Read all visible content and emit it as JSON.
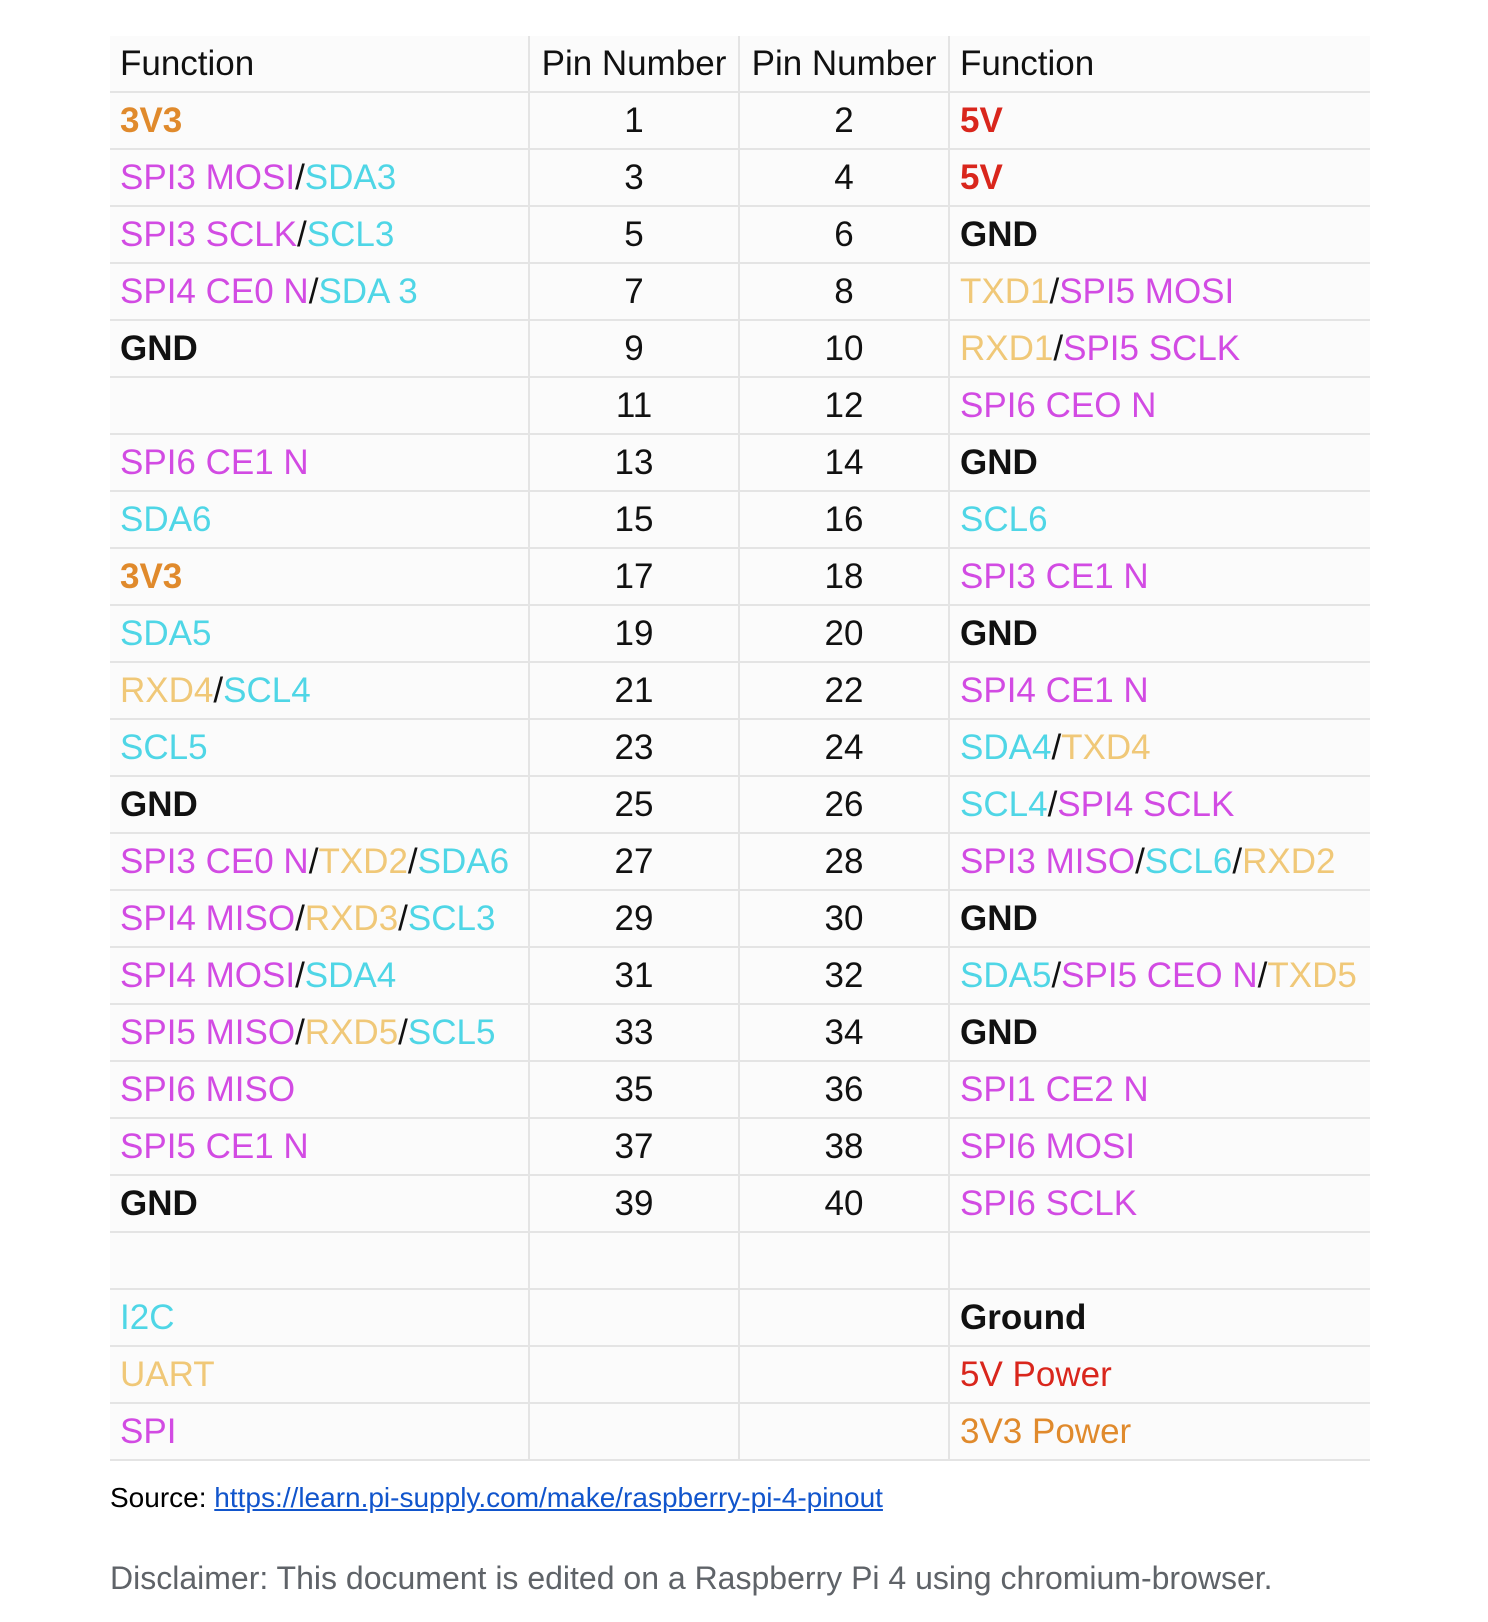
{
  "colors": {
    "spi": "#d24be3",
    "i2c": "#4fd6e6",
    "uart": "#f0c878",
    "power5v": "#d9261c",
    "power3v3": "#e08a2c",
    "ground": "#111111"
  },
  "table": {
    "headers": [
      "Function",
      "Pin Number",
      "Pin Number",
      "Function"
    ],
    "rows": [
      {
        "left": [
          {
            "t": "3V3",
            "c": "power3v3",
            "b": true
          }
        ],
        "pin_left": "1",
        "pin_right": "2",
        "right": [
          {
            "t": "5V",
            "c": "power5v",
            "b": true
          }
        ]
      },
      {
        "left": [
          {
            "t": "SPI3 MOSI",
            "c": "spi"
          },
          {
            "t": "/",
            "c": "ground"
          },
          {
            "t": "SDA3",
            "c": "i2c"
          }
        ],
        "pin_left": "3",
        "pin_right": "4",
        "right": [
          {
            "t": "5V",
            "c": "power5v",
            "b": true
          }
        ]
      },
      {
        "left": [
          {
            "t": "SPI3 SCLK",
            "c": "spi"
          },
          {
            "t": "/",
            "c": "ground"
          },
          {
            "t": "SCL3",
            "c": "i2c"
          }
        ],
        "pin_left": "5",
        "pin_right": "6",
        "right": [
          {
            "t": "GND",
            "c": "ground",
            "b": true
          }
        ]
      },
      {
        "left": [
          {
            "t": "SPI4 CE0 N",
            "c": "spi"
          },
          {
            "t": "/",
            "c": "ground"
          },
          {
            "t": "SDA 3",
            "c": "i2c"
          }
        ],
        "pin_left": "7",
        "pin_right": "8",
        "right": [
          {
            "t": "TXD1",
            "c": "uart"
          },
          {
            "t": "/",
            "c": "ground"
          },
          {
            "t": "SPI5 MOSI",
            "c": "spi"
          }
        ]
      },
      {
        "left": [
          {
            "t": "GND",
            "c": "ground",
            "b": true
          }
        ],
        "pin_left": "9",
        "pin_right": "10",
        "right": [
          {
            "t": "RXD1",
            "c": "uart"
          },
          {
            "t": "/",
            "c": "ground"
          },
          {
            "t": "SPI5 SCLK",
            "c": "spi"
          }
        ]
      },
      {
        "left": [],
        "pin_left": "11",
        "pin_right": "12",
        "right": [
          {
            "t": "SPI6 CEO N",
            "c": "spi"
          }
        ]
      },
      {
        "left": [
          {
            "t": "SPI6 CE1 N",
            "c": "spi"
          }
        ],
        "pin_left": "13",
        "pin_right": "14",
        "right": [
          {
            "t": "GND",
            "c": "ground",
            "b": true
          }
        ]
      },
      {
        "left": [
          {
            "t": "SDA6",
            "c": "i2c"
          }
        ],
        "pin_left": "15",
        "pin_right": "16",
        "right": [
          {
            "t": "SCL6",
            "c": "i2c"
          }
        ]
      },
      {
        "left": [
          {
            "t": "3V3",
            "c": "power3v3",
            "b": true
          }
        ],
        "pin_left": "17",
        "pin_right": "18",
        "right": [
          {
            "t": "SPI3 CE1 N",
            "c": "spi"
          }
        ]
      },
      {
        "left": [
          {
            "t": "SDA5",
            "c": "i2c"
          }
        ],
        "pin_left": "19",
        "pin_right": "20",
        "right": [
          {
            "t": "GND",
            "c": "ground",
            "b": true
          }
        ]
      },
      {
        "left": [
          {
            "t": "RXD4",
            "c": "uart"
          },
          {
            "t": "/",
            "c": "ground"
          },
          {
            "t": "SCL4",
            "c": "i2c"
          }
        ],
        "pin_left": "21",
        "pin_right": "22",
        "right": [
          {
            "t": "SPI4 CE1 N",
            "c": "spi"
          }
        ]
      },
      {
        "left": [
          {
            "t": "SCL5",
            "c": "i2c"
          }
        ],
        "pin_left": "23",
        "pin_right": "24",
        "right": [
          {
            "t": "SDA4",
            "c": "i2c"
          },
          {
            "t": "/",
            "c": "ground"
          },
          {
            "t": "TXD4",
            "c": "uart"
          }
        ]
      },
      {
        "left": [
          {
            "t": "GND",
            "c": "ground",
            "b": true
          }
        ],
        "pin_left": "25",
        "pin_right": "26",
        "right": [
          {
            "t": "SCL4",
            "c": "i2c"
          },
          {
            "t": "/",
            "c": "ground"
          },
          {
            "t": "SPI4 SCLK",
            "c": "spi"
          }
        ]
      },
      {
        "left": [
          {
            "t": "SPI3 CE0 N",
            "c": "spi"
          },
          {
            "t": "/",
            "c": "ground"
          },
          {
            "t": "TXD2",
            "c": "uart"
          },
          {
            "t": "/",
            "c": "ground"
          },
          {
            "t": "SDA6",
            "c": "i2c"
          }
        ],
        "pin_left": "27",
        "pin_right": "28",
        "right": [
          {
            "t": "SPI3 MISO",
            "c": "spi"
          },
          {
            "t": "/",
            "c": "ground"
          },
          {
            "t": "SCL6",
            "c": "i2c"
          },
          {
            "t": "/",
            "c": "ground"
          },
          {
            "t": "RXD2",
            "c": "uart"
          }
        ]
      },
      {
        "left": [
          {
            "t": "SPI4 MISO",
            "c": "spi"
          },
          {
            "t": "/",
            "c": "ground"
          },
          {
            "t": "RXD3",
            "c": "uart"
          },
          {
            "t": "/",
            "c": "ground"
          },
          {
            "t": "SCL3",
            "c": "i2c"
          }
        ],
        "pin_left": "29",
        "pin_right": "30",
        "right": [
          {
            "t": "GND",
            "c": "ground",
            "b": true
          }
        ]
      },
      {
        "left": [
          {
            "t": "SPI4 MOSI",
            "c": "spi"
          },
          {
            "t": "/",
            "c": "ground"
          },
          {
            "t": "SDA4",
            "c": "i2c"
          }
        ],
        "pin_left": "31",
        "pin_right": "32",
        "right": [
          {
            "t": "SDA5",
            "c": "i2c"
          },
          {
            "t": "/",
            "c": "ground"
          },
          {
            "t": "SPI5 CEO N",
            "c": "spi"
          },
          {
            "t": "/",
            "c": "ground"
          },
          {
            "t": "TXD5",
            "c": "uart"
          }
        ]
      },
      {
        "left": [
          {
            "t": "SPI5 MISO",
            "c": "spi"
          },
          {
            "t": "/",
            "c": "ground"
          },
          {
            "t": "RXD5",
            "c": "uart"
          },
          {
            "t": "/",
            "c": "ground"
          },
          {
            "t": "SCL5",
            "c": "i2c"
          }
        ],
        "pin_left": "33",
        "pin_right": "34",
        "right": [
          {
            "t": "GND",
            "c": "ground",
            "b": true
          }
        ]
      },
      {
        "left": [
          {
            "t": "SPI6 MISO",
            "c": "spi"
          }
        ],
        "pin_left": "35",
        "pin_right": "36",
        "right": [
          {
            "t": "SPI1 CE2 N",
            "c": "spi"
          }
        ]
      },
      {
        "left": [
          {
            "t": "SPI5 CE1 N",
            "c": "spi"
          }
        ],
        "pin_left": "37",
        "pin_right": "38",
        "right": [
          {
            "t": "SPI6 MOSI",
            "c": "spi"
          }
        ]
      },
      {
        "left": [
          {
            "t": "GND",
            "c": "ground",
            "b": true
          }
        ],
        "pin_left": "39",
        "pin_right": "40",
        "right": [
          {
            "t": "SPI6 SCLK",
            "c": "spi"
          }
        ]
      },
      {
        "left": [],
        "pin_left": "",
        "pin_right": "",
        "right": []
      },
      {
        "left": [
          {
            "t": "I2C",
            "c": "i2c"
          }
        ],
        "pin_left": "",
        "pin_right": "",
        "right": [
          {
            "t": "Ground",
            "c": "ground",
            "b": true
          }
        ]
      },
      {
        "left": [
          {
            "t": "UART",
            "c": "uart"
          }
        ],
        "pin_left": "",
        "pin_right": "",
        "right": [
          {
            "t": "5V Power",
            "c": "power5v"
          }
        ]
      },
      {
        "left": [
          {
            "t": "SPI",
            "c": "spi"
          }
        ],
        "pin_left": "",
        "pin_right": "",
        "right": [
          {
            "t": "3V3 Power",
            "c": "power3v3"
          }
        ]
      }
    ]
  },
  "source": {
    "label": "Source: ",
    "link_text": "https://learn.pi-supply.com/make/raspberry-pi-4-pinout"
  },
  "disclaimer": "Disclaimer: This document is edited on a Raspberry Pi 4 using chromium-browser."
}
